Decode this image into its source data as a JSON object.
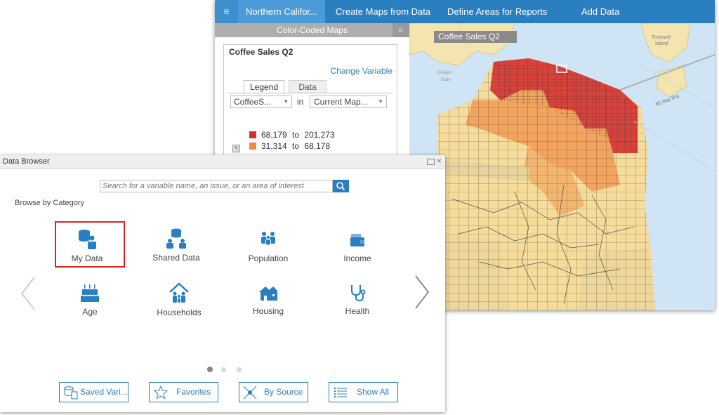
{
  "app": {
    "nav": {
      "menu_glyph": "≡",
      "project": "Northern Califor...",
      "create_maps": "Create Maps from Data",
      "define_areas": "Define Areas for Reports",
      "add_data": "Add Data"
    },
    "panel": {
      "header": "Color-Coded Maps",
      "collapse_glyph": "«",
      "map_title": "Coffee Sales Q2",
      "change_variable": "Change Variable",
      "tabs": [
        "Legend",
        "Data"
      ],
      "variable_select": "CoffeeS...",
      "in_label": "in",
      "geography_select": "Current Map...",
      "legend": [
        {
          "from": "68,179",
          "to_word": "to",
          "to": "201,273",
          "color": "#d73027"
        },
        {
          "from": "31,314",
          "to_word": "to",
          "to": "68,178",
          "color": "#f08a3a"
        }
      ]
    },
    "map": {
      "title": "Coffee Sales Q2",
      "labels": {
        "golden": "Golden",
        "gate": "Gate",
        "bay_bridge": "80-Bay Brg",
        "treasure": "Treasure",
        "island": "Island"
      },
      "colors": {
        "water": "#cfe4f5",
        "land": "#f7e6ad",
        "low": "#f5dc9b",
        "mid": "#f2a35e",
        "high": "#d9413b",
        "park": "#e8d39c"
      }
    }
  },
  "data_browser": {
    "title": "Data Browser",
    "search_placeholder": "Search for a variable name, an issue, or an area of interest",
    "browse_by_category": "Browse by Category",
    "categories": [
      {
        "label": "My Data",
        "icon": "my-data-icon",
        "selected": true
      },
      {
        "label": "Shared Data",
        "icon": "shared-data-icon"
      },
      {
        "label": "Population",
        "icon": "population-icon"
      },
      {
        "label": "Income",
        "icon": "income-icon"
      },
      {
        "label": "Age",
        "icon": "birthday-cake-icon"
      },
      {
        "label": "Households",
        "icon": "households-icon"
      },
      {
        "label": "Housing",
        "icon": "housing-icon"
      },
      {
        "label": "Health",
        "icon": "stethoscope-icon"
      }
    ],
    "pager": {
      "pages": 3,
      "current": 1
    },
    "footer_buttons": [
      "Saved Vari...",
      "Favorites",
      "By Source",
      "Show All"
    ],
    "accent": "#2a7fc0",
    "highlight": "#e0221c"
  }
}
